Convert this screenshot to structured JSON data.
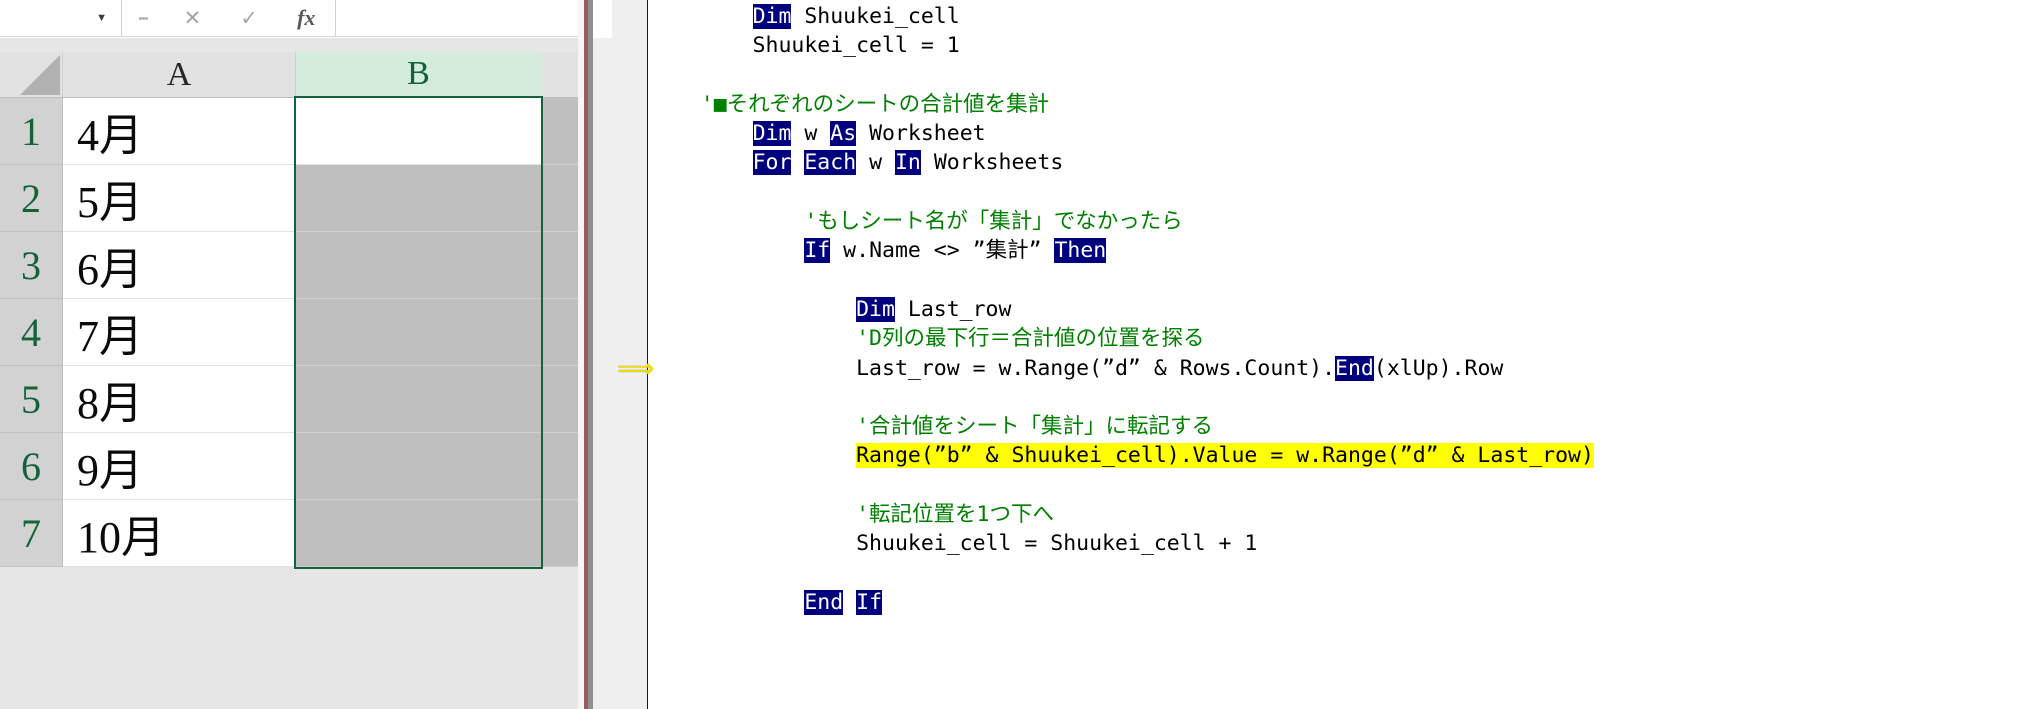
{
  "excel": {
    "formula_bar": {
      "name_box_value": "",
      "name_box_caret": "▼",
      "grip_icon": "vertical-dots",
      "cancel_icon": "✕",
      "confirm_icon": "✓",
      "function_icon": "fx",
      "formula_value": ""
    },
    "columns": [
      {
        "label": "A",
        "selected": false
      },
      {
        "label": "B",
        "selected": true
      }
    ],
    "rows": [
      {
        "num": "1",
        "a": "4月",
        "b": "",
        "b_active": true
      },
      {
        "num": "2",
        "a": "5月",
        "b": "",
        "b_active": false
      },
      {
        "num": "3",
        "a": "6月",
        "b": "",
        "b_active": false
      },
      {
        "num": "4",
        "a": "7月",
        "b": "",
        "b_active": false
      },
      {
        "num": "5",
        "a": "8月",
        "b": "",
        "b_active": false
      },
      {
        "num": "6",
        "a": "9月",
        "b": "",
        "b_active": false
      },
      {
        "num": "7",
        "a": "10月",
        "b": "",
        "b_active": false
      }
    ],
    "selection_range": "B1:B7",
    "active_cell": "B1",
    "colors": {
      "selected_header_bg": "#d4ecdc",
      "selected_header_text": "#13623b",
      "selection_border": "#13623b",
      "selection_fill": "#bfbfbf"
    }
  },
  "vba": {
    "margin_marker_icon": "yellow-right-arrow",
    "colors": {
      "keyword_bg": "#00007f",
      "keyword_text": "#ffffff",
      "comment_text": "#008000",
      "highlight_bg": "#ffff00",
      "code_text": "#000000"
    },
    "lines": [
      "        Dim Shuukei_cell",
      "        Shuukei_cell = 1",
      "",
      "    '■それぞれのシートの合計値を集計",
      "        Dim w As Worksheet",
      "        For Each w In Worksheets",
      "",
      "            'もしシート名が「集計」でなかったら",
      "            If w.Name <> ”集計” Then",
      "",
      "                Dim Last_row",
      "                'D列の最下行＝合計値の位置を探る",
      "                Last_row = w.Range(”d” & Rows.Count).End(xlUp).Row",
      "",
      "                '合計値をシート「集計」に転記する",
      "                Range(”b” & Shuukei_cell).Value = w.Range(”d” & Last_row)",
      "",
      "                '転記位置を1つ下へ",
      "                Shuukei_cell = Shuukei_cell + 1",
      "",
      "            End If"
    ],
    "keywords": [
      "Dim",
      "As",
      "For",
      "Each",
      "In",
      "If",
      "Then",
      "End"
    ],
    "highlighted_line_index": 15,
    "highlighted_line_text": "Range(”b” & Shuukei_cell).Value = w.Range(”d” & Last_row)"
  }
}
